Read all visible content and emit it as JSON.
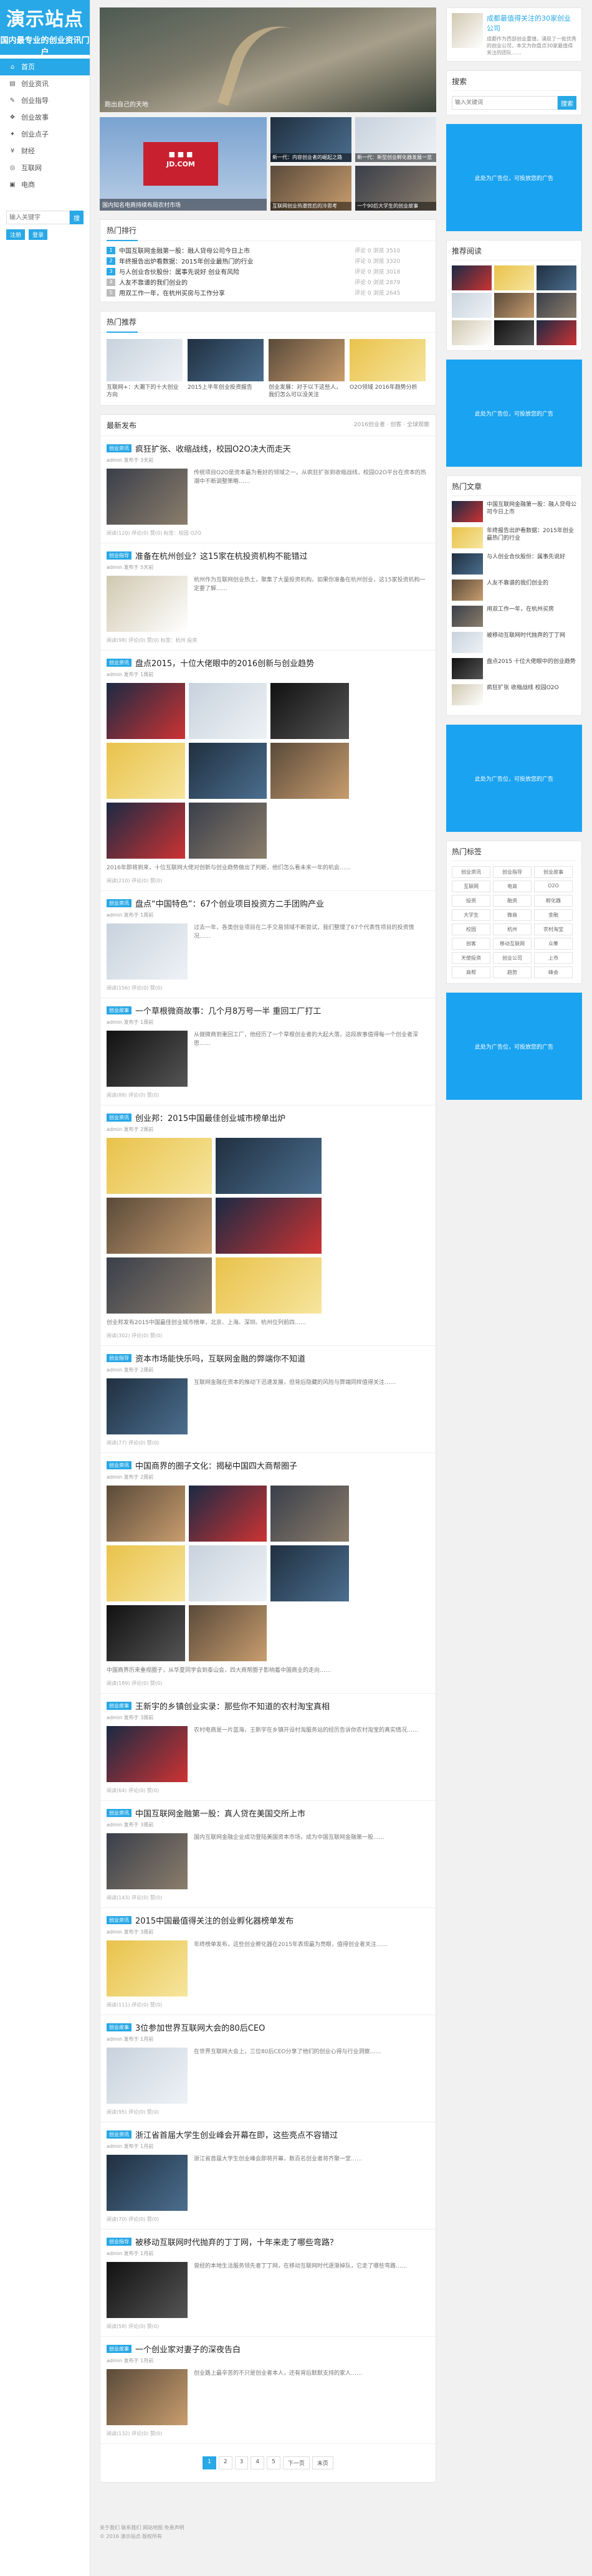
{
  "logo": {
    "line1": "演示站点",
    "line2": "国内最专业的创业资讯门户"
  },
  "nav": [
    {
      "label": "首页",
      "icon": "home-icon"
    },
    {
      "label": "创业资讯",
      "icon": "news-icon"
    },
    {
      "label": "创业指导",
      "icon": "guide-icon"
    },
    {
      "label": "创业故事",
      "icon": "story-icon"
    },
    {
      "label": "创业点子",
      "icon": "idea-icon"
    },
    {
      "label": "财经",
      "icon": "finance-icon"
    },
    {
      "label": "互联网",
      "icon": "web-icon"
    },
    {
      "label": "电商",
      "icon": "shop-icon"
    }
  ],
  "side_search": {
    "placeholder": "输入关键字",
    "button": "搜"
  },
  "side_btns": [
    "注册",
    "登录"
  ],
  "hero": {
    "slider_caption": "跑出自己的天地",
    "big_caption": "国内知名电商持续布局农村市场",
    "grid": [
      {
        "caption": "新一代：内容创业者的崛起之路"
      },
      {
        "caption": "新一代：新型创业孵化器发展一览"
      },
      {
        "caption": "互联网创业热潮背后的冷思考"
      },
      {
        "caption": "一个90后大学生的创业故事"
      }
    ]
  },
  "hot": {
    "title": "热门排行",
    "rows": [
      {
        "n": "1",
        "t": "中国互联网金融第一股：融人贷母公司今日上市",
        "m": "评论 0 浏览 3510"
      },
      {
        "n": "2",
        "t": "年终报告出炉看数据：2015年创业最热门的行业",
        "m": "评论 0 浏览 3320"
      },
      {
        "n": "3",
        "t": "与人创业合伙股份：属事先说好 创业有风险",
        "m": "评论 0 浏览 3018"
      },
      {
        "n": "4",
        "t": "人友不靠谱的我们创业的",
        "m": "评论 0 浏览 2879"
      },
      {
        "n": "5",
        "t": "用双工作一年，在杭州买房与工作分享",
        "m": "评论 0 浏览 2645"
      }
    ]
  },
  "recommend": {
    "title": "热门推荐",
    "items": [
      {
        "t": "互联网+：大潮下的十大创业方向"
      },
      {
        "t": "2015上半年创业投资报告"
      },
      {
        "t": "创业发展：对于以下这些人，我们怎么可以没关注"
      },
      {
        "t": "O2O领域 2016年趋势分析"
      }
    ]
  },
  "latest": {
    "title": "最新发布",
    "tabs": "2016创业者 · 创客 · 全球观察"
  },
  "posts": [
    {
      "tag": "创业资讯",
      "title": "疯狂扩张、收缩战线，校园O2O决大而走天",
      "meta": "admin 发布于 3天前",
      "excerpt": "传统项目O2O是资本最为看好的领域之一。从疯狂扩张到收缩战线，校园O2O平台在资本的热潮中不断调整策略……",
      "foot": "阅读(120)  评论(0)  赞(0)  标签：校园 O2O"
    },
    {
      "tag": "创业指导",
      "title": "准备在杭州创业？这15家在杭投资机构不能错过",
      "meta": "admin 发布于 5天前",
      "excerpt": "杭州作为互联网创业热土，聚集了大量投资机构。如果你准备在杭州创业，这15家投资机构一定要了解……",
      "foot": "阅读(98)  评论(0)  赞(0)  标签：杭州 投资"
    },
    {
      "tag": "创业资讯",
      "title": "盘点2015，十位大佬眼中的2016创新与创业趋势",
      "meta": "admin 发布于 1周前",
      "excerpt": "2016年即将到来，十位互联网大佬对创新与创业趋势做出了判断，他们怎么看未来一年的机会……",
      "foot": "阅读(210)  评论(0)  赞(0)"
    },
    {
      "tag": "创业资讯",
      "title": "盘点“中国特色”：67个创业项目投资方二手团购产业",
      "meta": "admin 发布于 1周前",
      "excerpt": "过去一年，各类创业项目在二手交易领域不断尝试，我们整理了67个代表性项目的投资情况……",
      "foot": "阅读(156)  评论(0)  赞(0)"
    },
    {
      "tag": "创业故事",
      "title": "一个草根微商故事：几个月8万号一半 重回工厂打工",
      "meta": "admin 发布于 1周前",
      "excerpt": "从做微商到重回工厂，他经历了一个草根创业者的大起大落，这段故事值得每一个创业者深思……",
      "foot": "阅读(88)  评论(0)  赞(0)"
    },
    {
      "tag": "创业资讯",
      "title": "创业邦：2015中国最佳创业城市榜单出炉",
      "meta": "admin 发布于 2周前",
      "excerpt": "创业邦发布2015中国最佳创业城市榜单，北京、上海、深圳、杭州位列前四……",
      "foot": "阅读(302)  评论(0)  赞(0)"
    },
    {
      "tag": "创业指导",
      "title": "资本市场能快乐吗，互联网金融的弊端你不知道",
      "meta": "admin 发布于 2周前",
      "excerpt": "互联网金融在资本的推动下迅速发展，但背后隐藏的风险与弊端同样值得关注……",
      "foot": "阅读(77)  评论(0)  赞(0)"
    },
    {
      "tag": "创业资讯",
      "title": "中国商界的圈子文化：揭秘中国四大商帮圈子",
      "meta": "admin 发布于 2周前",
      "excerpt": "中国商界历来重视圈子，从华夏同学会到泰山会，四大商帮圈子影响着中国商业的走向……",
      "foot": "阅读(189)  评论(0)  赞(0)"
    },
    {
      "tag": "创业故事",
      "title": "王新宇的乡镇创业实录：那些你不知道的农村淘宝真相",
      "meta": "admin 发布于 3周前",
      "excerpt": "农村电商是一片蓝海，王新宇在乡镇开设村淘服务站的经历告诉你农村淘宝的真实情况……",
      "foot": "阅读(64)  评论(0)  赞(0)"
    },
    {
      "tag": "创业资讯",
      "title": "中国互联网金融第一股：真人贷在美国交所上市",
      "meta": "admin 发布于 3周前",
      "excerpt": "国内互联网金融企业成功登陆美国资本市场，成为中国互联网金融第一股……",
      "foot": "阅读(143)  评论(0)  赞(0)"
    },
    {
      "tag": "创业资讯",
      "title": "2015中国最值得关注的创业孵化器榜单发布",
      "meta": "admin 发布于 3周前",
      "excerpt": "年终榜单发布，这些创业孵化器在2015年表现最为亮眼，值得创业者关注……",
      "foot": "阅读(111)  评论(0)  赞(0)"
    },
    {
      "tag": "创业故事",
      "title": "3位参加世界互联网大会的80后CEO",
      "meta": "admin 发布于 1月前",
      "excerpt": "在世界互联网大会上，三位80后CEO分享了他们的创业心得与行业洞察……",
      "foot": "阅读(95)  评论(0)  赞(0)"
    },
    {
      "tag": "创业资讯",
      "title": "浙江省首届大学生创业峰会开幕在即，这些亮点不容错过",
      "meta": "admin 发布于 1月前",
      "excerpt": "浙江省首届大学生创业峰会即将开幕，数百名创业者将齐聚一堂……",
      "foot": "阅读(70)  评论(0)  赞(0)"
    },
    {
      "tag": "创业指导",
      "title": "被移动互联网时代抛弃的丁丁网，十年来走了哪些弯路？",
      "meta": "admin 发布于 1月前",
      "excerpt": "曾经的本地生活服务领先者丁丁网，在移动互联网时代逐渐掉队，它走了哪些弯路……",
      "foot": "阅读(58)  评论(0)  赞(0)"
    },
    {
      "tag": "创业故事",
      "title": "一个创业家对妻子的深夜告白",
      "meta": "admin 发布于 1月前",
      "excerpt": "创业路上最辛苦的不只是创业者本人，还有背后默默支持的家人……",
      "foot": "阅读(132)  评论(0)  赞(0)"
    }
  ],
  "pager": [
    "1",
    "2",
    "3",
    "4",
    "5",
    "下一页",
    "末页"
  ],
  "right": {
    "top_title": "成都最值得关注的30家创业公司",
    "top_excerpt": "成都作为西部创业重镇，涌现了一批优秀的创业公司，本文为你盘点30家最值得关注的团队……",
    "search_title": "搜索",
    "search_placeholder": "输入关键词",
    "search_button": "搜索",
    "ad_text": "此处为广告位，可投放您的广告",
    "photos_title": "推荐阅读",
    "articles_title": "热门文章",
    "articles": [
      {
        "t": "中国互联网金融第一股：融人贷母公司今日上市"
      },
      {
        "t": "年终报告出炉看数据：2015年创业最热门的行业"
      },
      {
        "t": "与人创业合伙股份：属事先说好"
      },
      {
        "t": "人友不靠谱的我们创业的"
      },
      {
        "t": "用双工作一年，在杭州买房"
      },
      {
        "t": "被移动互联网时代抛弃的丁丁网"
      },
      {
        "t": "盘点2015 十位大佬眼中的创业趋势"
      },
      {
        "t": "疯狂扩张 收缩战线 校园O2O"
      }
    ],
    "tags_title": "热门标签",
    "tags": [
      "创业资讯",
      "创业指导",
      "创业故事",
      "互联网",
      "电商",
      "O2O",
      "投资",
      "融资",
      "孵化器",
      "大学生",
      "微商",
      "金融",
      "校园",
      "杭州",
      "农村淘宝",
      "创客",
      "移动互联网",
      "众筹",
      "天使投资",
      "创业公司",
      "上市",
      "商帮",
      "趋势",
      "峰会"
    ]
  },
  "footer": {
    "line1": "关于我们  联系我们  网站地图  免责声明",
    "line2": "© 2016 演示站点  版权所有"
  }
}
